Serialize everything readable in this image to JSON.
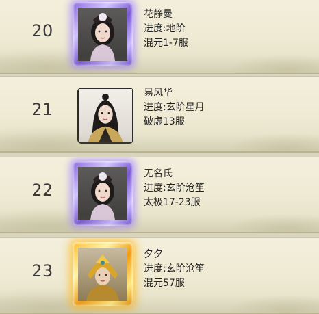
{
  "rows": [
    {
      "rank": "20",
      "name": "花静曼",
      "progress": "进度:地阶",
      "realm": "混元1-7服",
      "frame": "purple",
      "avatar_icon": "female-hero-portrait-icon"
    },
    {
      "rank": "21",
      "name": "易风华",
      "progress": "进度:玄阶星月",
      "realm": "破虚13服",
      "frame": "plain",
      "avatar_icon": "male-hero-portrait-icon"
    },
    {
      "rank": "22",
      "name": "无名氏",
      "progress": "进度:玄阶沧笙",
      "realm": "太极17-23服",
      "frame": "purple",
      "avatar_icon": "female-hero-portrait-icon"
    },
    {
      "rank": "23",
      "name": "夕夕",
      "progress": "进度:玄阶沧笙",
      "realm": "混元57服",
      "frame": "gold",
      "avatar_icon": "armored-hero-portrait-icon"
    }
  ],
  "colors": {
    "frame_purple": "#8c6bdf",
    "frame_gold": "#f2b21e",
    "text": "#222222"
  }
}
